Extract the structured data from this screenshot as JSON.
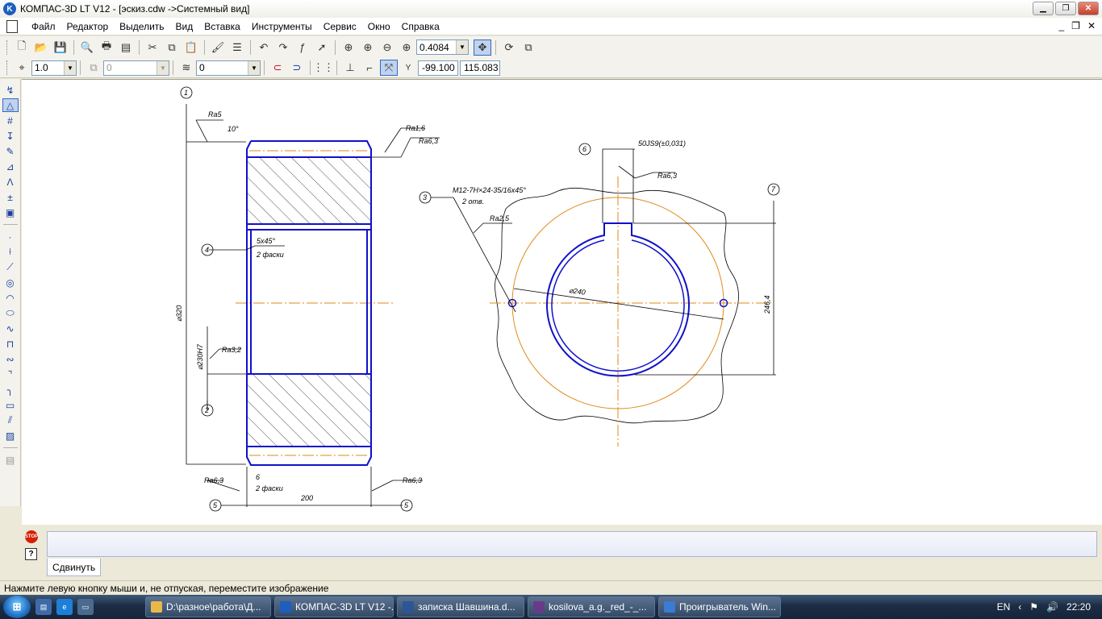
{
  "window": {
    "title": "КОМПАС-3D LT V12 - [эскиз.cdw ->Системный вид]",
    "logo": "K"
  },
  "menu": {
    "items": [
      "Файл",
      "Редактор",
      "Выделить",
      "Вид",
      "Вставка",
      "Инструменты",
      "Сервис",
      "Окно",
      "Справка"
    ]
  },
  "toolbar1": {
    "zoom_value": "0.4084"
  },
  "toolbar2": {
    "scale_value": "1.0",
    "layer_value": "0",
    "style_value": "0",
    "coord_x": "-99.100",
    "coord_y": "115.083",
    "coord_label": "Y"
  },
  "drawing": {
    "dims": {
      "ra5": "Ra5",
      "angle10": "10°",
      "ra16": "Ra1,6",
      "ra63_top": "Ra6,3",
      "chamfer": "5х45°",
      "chamfer_count": "2 фаски",
      "d320": "⌀320",
      "d230": "⌀230H7",
      "ra32": "Ra3,2",
      "ra63_bl": "Ra6,3",
      "ra63_br": "Ra6,3",
      "small6": "6",
      "chamfer_count_bottom": "2 фаски",
      "width200": "200",
      "keyway": "50JS9(±0,031)",
      "ra63_key": "Ra6,3",
      "thread": "М12-7Н×24-35/16х45°",
      "thread_count": "2 отв.",
      "ra25": "Ra2,5",
      "d240": "⌀240",
      "d246": "246,4",
      "l1": "1",
      "l2": "2",
      "l3": "3",
      "l4": "4",
      "l5a": "5",
      "l5b": "5",
      "l6": "6",
      "l7": "7",
      "l1b": "1"
    }
  },
  "properties": {
    "tab_label": "Сдвинуть"
  },
  "statusbar": {
    "text": "Нажмите левую кнопку мыши и, не отпуская, переместите изображение"
  },
  "taskbar": {
    "tasks": [
      {
        "label": "D:\\разное\\работа\\Д...",
        "color": "#e8b94a"
      },
      {
        "label": "КОМПАС-3D LT V12 -...",
        "color": "#1d5fbf"
      },
      {
        "label": "записка Шавшина.d...",
        "color": "#2b5797"
      },
      {
        "label": "kosilova_a.g._red_-_...",
        "color": "#6a3a8a"
      },
      {
        "label": "Проигрыватель Win...",
        "color": "#3b7bd4"
      }
    ],
    "lang": "EN",
    "clock": "22:20"
  },
  "colors": {
    "contour": "#1010cc",
    "axis": "#e08a1a",
    "dim": "#000000"
  }
}
